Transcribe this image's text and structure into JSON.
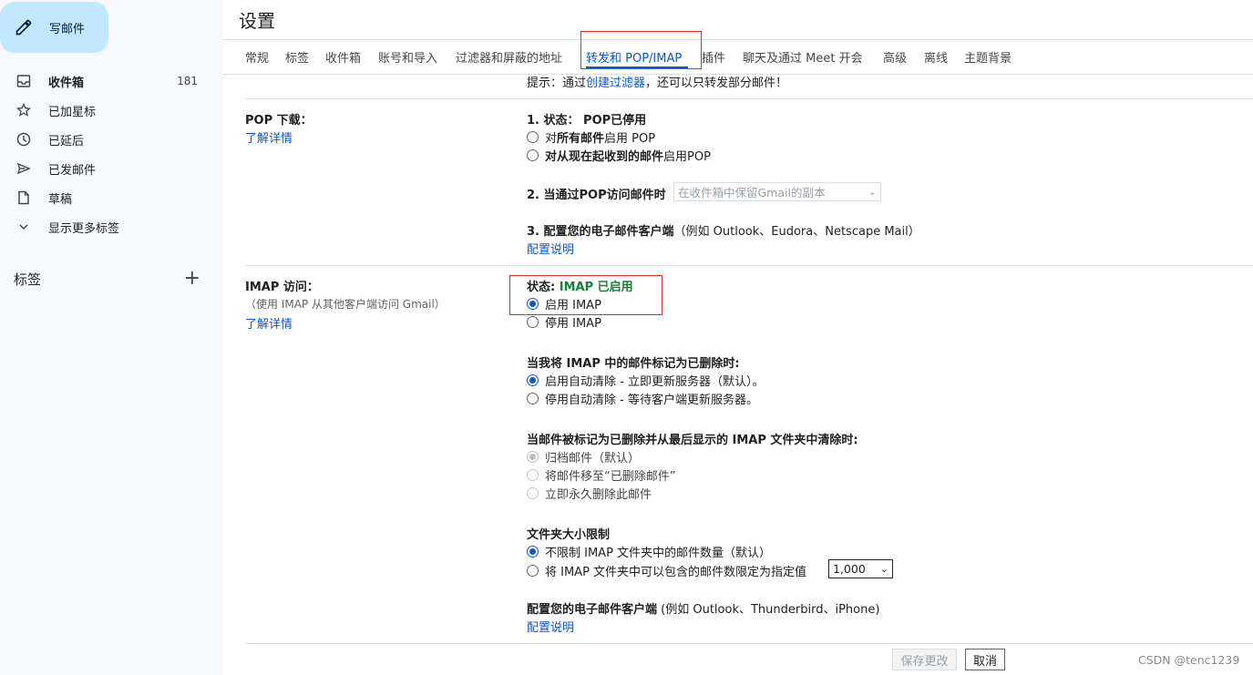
{
  "sidebar": {
    "compose_label": "写邮件",
    "items": [
      {
        "label": "收件箱",
        "count": "181",
        "icon": "inbox-icon"
      },
      {
        "label": "已加星标",
        "icon": "star-icon"
      },
      {
        "label": "已延后",
        "icon": "clock-icon"
      },
      {
        "label": "已发邮件",
        "icon": "send-icon"
      },
      {
        "label": "草稿",
        "icon": "draft-icon"
      },
      {
        "label": "显示更多标签",
        "icon": "chevron-down-icon"
      }
    ],
    "labels_heading": "标签",
    "labels_add": "+"
  },
  "settings": {
    "title": "设置",
    "tabs": [
      "常规",
      "标签",
      "收件箱",
      "账号和导入",
      "过滤器和屏蔽的地址",
      "转发和 POP/IMAP",
      "插件",
      "聊天及通过 Meet 开会",
      "高级",
      "离线",
      "主题背景"
    ],
    "active_tab_index": 5,
    "forward_hint_prefix": "提示：通过",
    "forward_hint_link": "创建过滤器",
    "forward_hint_suffix": "，还可以只转发部分邮件！",
    "pop": {
      "heading": "POP 下载：",
      "learn_more": "了解详情",
      "step1_prefix": "1. 状态：",
      "step1_status": "POP已停用",
      "opt_all_pre": "对",
      "opt_all_bold": "所有邮件",
      "opt_all_post": "启用 POP",
      "opt_now_bold": "对从现在起收到的邮件",
      "opt_now_post": "启用POP",
      "step2_label": "2. 当通过POP访问邮件时",
      "step2_select": "在收件箱中保留Gmail的副本",
      "step3_bold": "3. 配置您的电子邮件客户端",
      "step3_note": "（例如 Outlook、Eudora、Netscape Mail）",
      "config_link": "配置说明"
    },
    "imap": {
      "heading": "IMAP 访问：",
      "subtitle": "（使用 IMAP 从其他客户端访问 Gmail）",
      "learn_more": "了解详情",
      "status_label": "状态:",
      "status_value": "IMAP 已启用",
      "enable": "启用 IMAP",
      "disable": "停用 IMAP",
      "expunge_heading": "当我将 IMAP 中的邮件标记为已删除时:",
      "expunge_on": "启用自动清除 - 立即更新服务器（默认）。",
      "expunge_off": "停用自动清除 - 等待客户端更新服务器。",
      "delete_heading": "当邮件被标记为已删除并从最后显示的 IMAP 文件夹中清除时:",
      "delete_archive": "归档邮件（默认）",
      "delete_trash": "将邮件移至“已删除邮件”",
      "delete_forever": "立即永久删除此邮件",
      "folder_heading": "文件夹大小限制",
      "folder_unlimited": "不限制 IMAP 文件夹中的邮件数量（默认）",
      "folder_limit": "将 IMAP 文件夹中可以包含的邮件数限定为指定值",
      "folder_limit_value": "1,000",
      "client_bold": "配置您的电子邮件客户端",
      "client_note": " (例如 Outlook、Thunderbird、iPhone)",
      "config_link": "配置说明"
    },
    "save_label": "保存更改",
    "cancel_label": "取消"
  },
  "watermark": "CSDN @tenc1239",
  "colors": {
    "accent": "#0b57d0",
    "compose_bg": "#c2e7ff",
    "status_green": "#188038",
    "highlight_box": "#d93025"
  }
}
